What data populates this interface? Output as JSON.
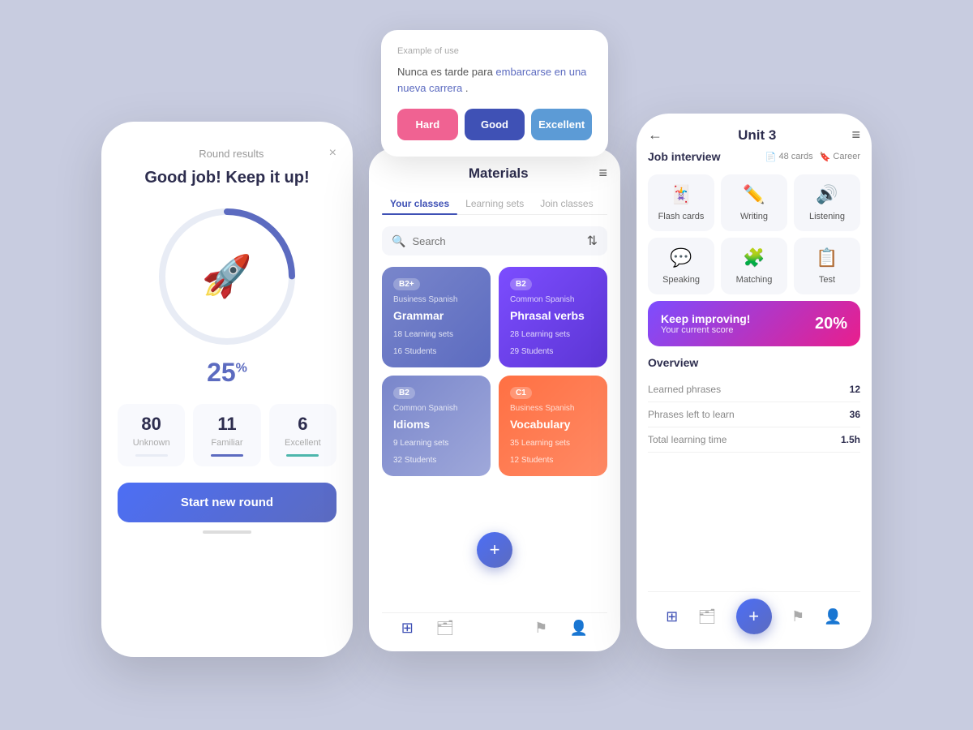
{
  "page": {
    "bg_color": "#c8cce0"
  },
  "phone1": {
    "round_results_label": "Round results",
    "close_label": "×",
    "headline": "Good job! Keep it up!",
    "percent": "25",
    "percent_symbol": "%",
    "stats": [
      {
        "num": "80",
        "label": "Unknown"
      },
      {
        "num": "11",
        "label": "Familiar"
      },
      {
        "num": "6",
        "label": "Excellent"
      }
    ],
    "start_btn": "Start new round"
  },
  "phone2_card": {
    "example_label": "Example of use",
    "spanish": "Nunca es tarde para ",
    "link_text": "embarcarse en una nueva carrera",
    "period": ".",
    "btn_hard": "Hard",
    "btn_good": "Good",
    "btn_excellent": "Excellent"
  },
  "phone2_materials": {
    "title": "Materials",
    "hamburger": "≡",
    "tabs": [
      {
        "label": "Your classes",
        "active": true
      },
      {
        "label": "Learning sets",
        "active": false
      },
      {
        "label": "Join classes",
        "active": false
      }
    ],
    "search_placeholder": "Search",
    "cards": [
      {
        "badge": "B2+",
        "sub": "Business Spanish",
        "name": "Grammar",
        "learning_sets": "18",
        "students": "16",
        "color": "blue"
      },
      {
        "badge": "B2",
        "sub": "Common Spanish",
        "name": "Phrasal verbs",
        "learning_sets": "28",
        "students": "29",
        "color": "purple"
      },
      {
        "badge": "B2",
        "sub": "Common Spanish",
        "name": "Idioms",
        "learning_sets": "9",
        "students": "32",
        "color": "indigo"
      },
      {
        "badge": "C1",
        "sub": "Business Spanish",
        "name": "Vocabulary",
        "learning_sets": "35",
        "students": "12",
        "color": "coral"
      }
    ],
    "nav_icons": [
      "⊞",
      "🗂",
      "⚑",
      "👤"
    ]
  },
  "phone3": {
    "back": "←",
    "title": "Unit 3",
    "menu": "≡",
    "job_title": "Job interview",
    "badge_cards": "48 cards",
    "badge_career": "Career",
    "modes": [
      {
        "icon": "🃏",
        "label": "Flash cards"
      },
      {
        "icon": "✍",
        "label": "Writing"
      },
      {
        "icon": "🔊",
        "label": "Listening"
      },
      {
        "icon": "💬",
        "label": "Speaking"
      },
      {
        "icon": "🧩",
        "label": "Matching"
      },
      {
        "icon": "📋",
        "label": "Test"
      }
    ],
    "improve_title": "Keep improving!",
    "improve_sub": "Your current score",
    "improve_score": "20%",
    "overview_title": "Overview",
    "overview_rows": [
      {
        "key": "Learned phrases",
        "val": "12"
      },
      {
        "key": "Phrases left to learn",
        "val": "36"
      },
      {
        "key": "Total learning time",
        "val": "1.5h"
      }
    ],
    "nav_icons": [
      "⊞",
      "🗂",
      "+",
      "⚑",
      "👤"
    ]
  }
}
